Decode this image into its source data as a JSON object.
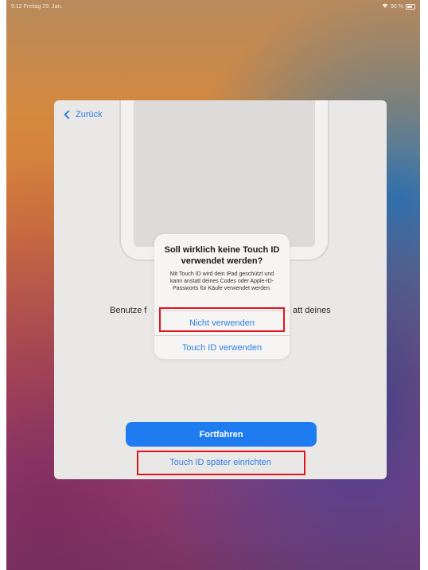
{
  "status_bar": {
    "time_date": "9:12 Freitag 29. Jan.",
    "wifi_battery": "90 %"
  },
  "nav": {
    "back_label": "Zurück"
  },
  "background_text": {
    "left": "Benutze f",
    "right": "att deines"
  },
  "alert": {
    "title": "Soll wirklich keine Touch ID verwendet werden?",
    "message": "Mit Touch ID wird dein iPad geschützt und kann anstatt deines Codes oder Apple-ID-Passworts für Käufe verwendet werden.",
    "dont_use_label": "Nicht verwenden",
    "use_touch_id_label": "Touch ID verwenden"
  },
  "buttons": {
    "continue_label": "Fortfahren",
    "setup_later_label": "Touch ID später einrichten"
  },
  "colors": {
    "accent": "#2f7fe6",
    "primary": "#1f7cf0",
    "highlight": "#e0151e"
  },
  "icons": {
    "back": "chevron-left-icon",
    "wifi": "wifi-icon",
    "battery": "battery-icon"
  }
}
